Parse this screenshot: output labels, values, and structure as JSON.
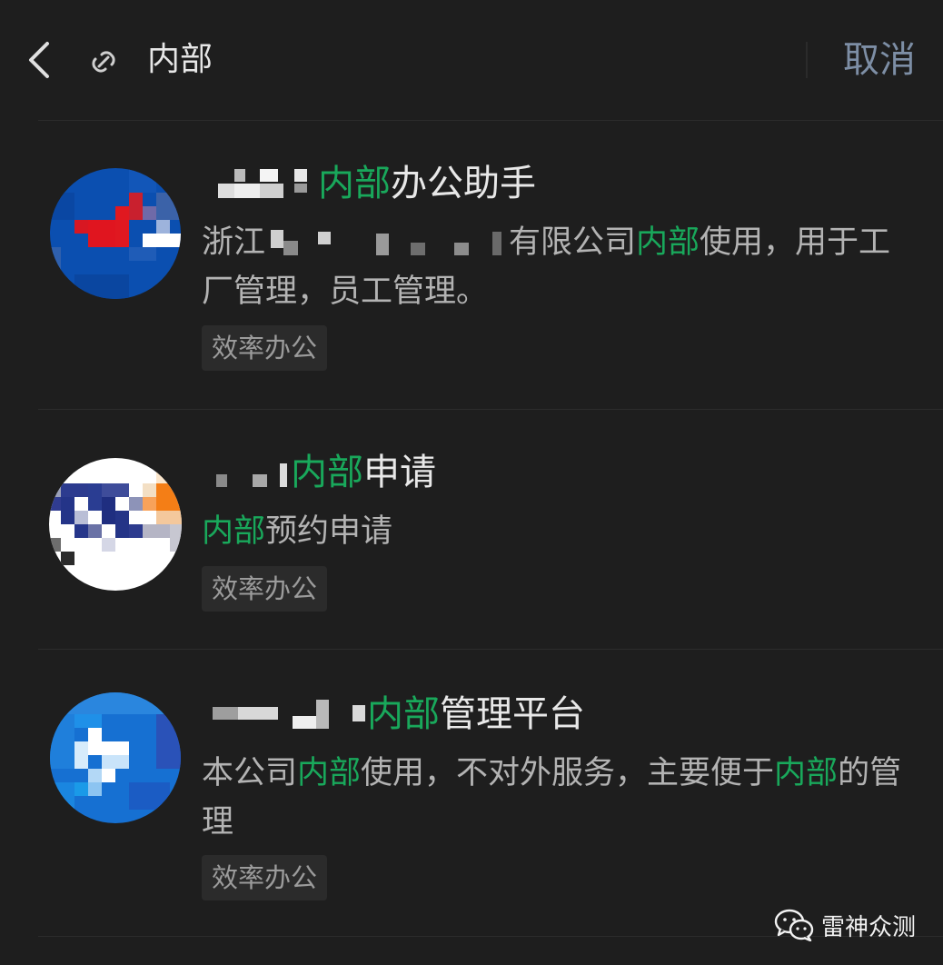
{
  "header": {
    "search_query": "内部",
    "cancel_label": "取消"
  },
  "results": [
    {
      "title_pre": "",
      "title_hl": "内部",
      "title_post": "办公助手",
      "desc_pre": "浙江",
      "desc_mid": "有限公司",
      "desc_hl": "内部",
      "desc_post": "使用，用于工厂管理，员工管理。",
      "tag": "效率办公"
    },
    {
      "title_pre": "",
      "title_hl": "内部",
      "title_post": "申请",
      "desc_hl": "内部",
      "desc_post": "预约申请",
      "tag": "效率办公"
    },
    {
      "title_pre": "",
      "title_hl": "内部",
      "title_post": "管理平台",
      "desc_pre": "本公司",
      "desc_hl": "内部",
      "desc_mid": "使用，不对外服务，主要便于",
      "desc_hl2": "内部",
      "desc_post": "的管理",
      "tag": "效率办公"
    }
  ],
  "watermark": {
    "text": "雷神众测",
    "icon": "wechat-icon"
  },
  "colors": {
    "background": "#1e1e1e",
    "highlight": "#19a85b",
    "cancel": "#7d8ea5",
    "tag_bg": "#2b2b2b"
  }
}
